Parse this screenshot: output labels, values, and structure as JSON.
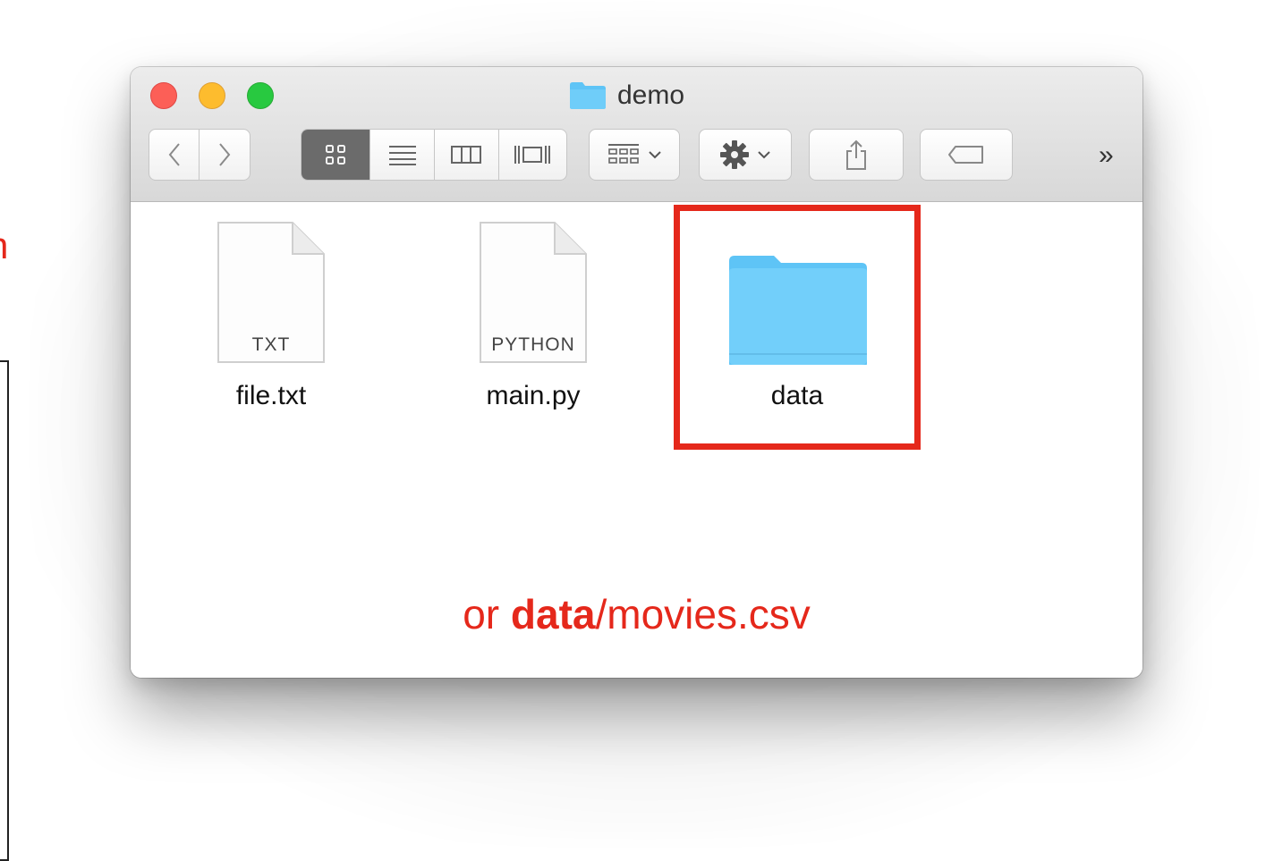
{
  "window": {
    "title": "demo"
  },
  "toolbar": {
    "overflow_label": "»"
  },
  "files": [
    {
      "name": "file.txt",
      "type_label": "TXT",
      "kind": "document"
    },
    {
      "name": "main.py",
      "type_label": "PYTHON",
      "kind": "document"
    },
    {
      "name": "data",
      "kind": "folder"
    }
  ],
  "annotation": {
    "prefix": "or ",
    "highlight": "data",
    "suffix": "/movies.csv",
    "color": "#e5281b"
  },
  "left_fragment": {
    "text": "n"
  }
}
